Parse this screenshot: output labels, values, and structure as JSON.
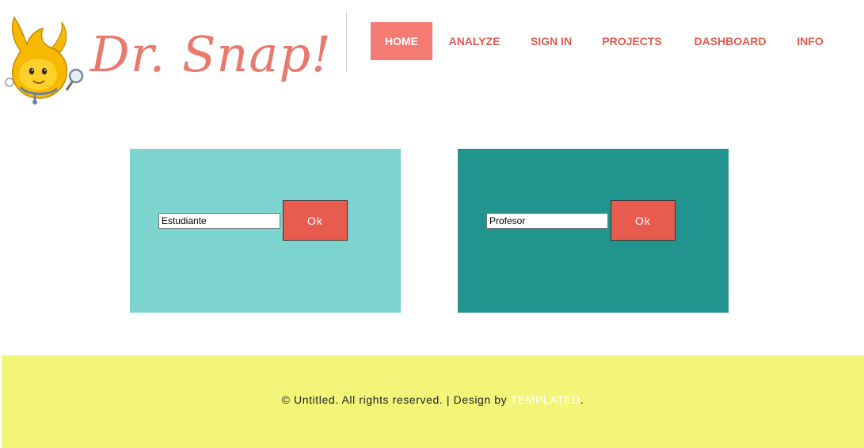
{
  "brand": {
    "name": "Dr. Snap!",
    "accent": "#e9786d"
  },
  "nav": {
    "items": [
      {
        "label": "HOME",
        "active": true
      },
      {
        "label": "ANALYZE",
        "active": false
      },
      {
        "label": "SIGN IN",
        "active": false
      },
      {
        "label": "PROJECTS",
        "active": false
      },
      {
        "label": "DASHBOARD",
        "active": false
      },
      {
        "label": "INFO",
        "active": false
      }
    ]
  },
  "student": {
    "input_value": "Estudiante",
    "button_label": "Ok",
    "panel_color": "#7dd3cd"
  },
  "teacher": {
    "input_value": "Profesor",
    "button_label": "Ok",
    "panel_color": "#21958d"
  },
  "footer": {
    "prefix": "© Untitled. All rights reserved. | Design by ",
    "link_text": "TEMPLATED",
    "suffix": ".",
    "background": "#f2f578"
  },
  "colors": {
    "button": "#e85c50",
    "nav_active": "#f47b73",
    "nav_text": "#e35a4e"
  }
}
